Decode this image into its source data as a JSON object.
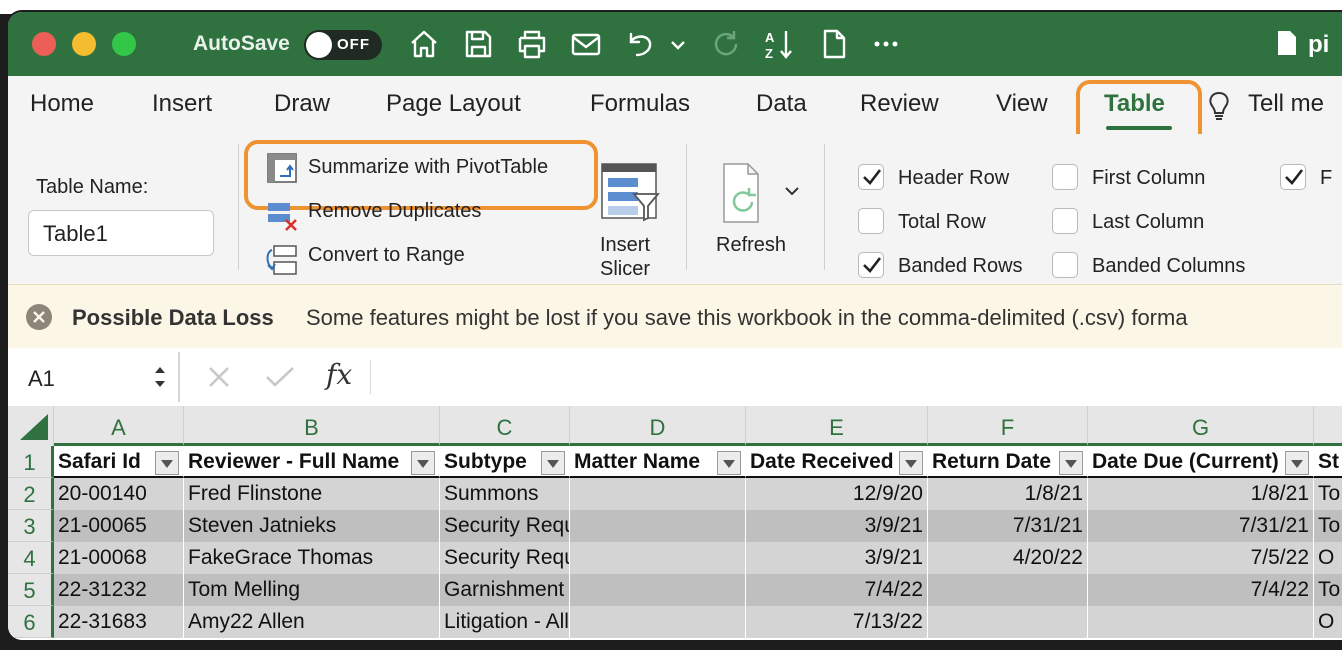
{
  "titlebar": {
    "autosave_label": "AutoSave",
    "autosave_state": "OFF",
    "filename": "pi",
    "colors": {
      "bar": "#2f7240",
      "close": "#ec5f57",
      "minimize": "#f4bd2f",
      "zoom": "#33c748"
    },
    "icons": [
      "home-icon",
      "save-icon",
      "print-icon",
      "mail-icon",
      "undo-icon",
      "chevron-down-icon",
      "redo-icon",
      "sort-az-icon",
      "document-icon",
      "more-icon"
    ]
  },
  "tabs": {
    "items": [
      "Home",
      "Insert",
      "Draw",
      "Page Layout",
      "Formulas",
      "Data",
      "Review",
      "View",
      "Table"
    ],
    "active": "Table",
    "tell_me": "Tell me",
    "highlight_color": "#ef9232"
  },
  "ribbon": {
    "table_name_label": "Table Name:",
    "table_name_value": "Table1",
    "summarize": "Summarize with PivotTable",
    "remove_duplicates": "Remove Duplicates",
    "convert_range": "Convert to Range",
    "insert_slicer_1": "Insert",
    "insert_slicer_2": "Slicer",
    "refresh": "Refresh",
    "options": {
      "header_row": {
        "label": "Header Row",
        "checked": true
      },
      "total_row": {
        "label": "Total Row",
        "checked": false
      },
      "banded_rows": {
        "label": "Banded Rows",
        "checked": true
      },
      "first_column": {
        "label": "First Column",
        "checked": false
      },
      "last_column": {
        "label": "Last Column",
        "checked": false
      },
      "banded_columns": {
        "label": "Banded Columns",
        "checked": false
      },
      "filter_button": {
        "label": "F",
        "checked": true
      }
    }
  },
  "message_bar": {
    "title": "Possible Data Loss",
    "text": "Some features might be lost if you save this workbook in the comma-delimited (.csv) forma"
  },
  "formula_bar": {
    "cell_ref": "A1",
    "fx": "fx",
    "content": ""
  },
  "sheet": {
    "columns": [
      "A",
      "B",
      "C",
      "D",
      "E",
      "F",
      "G"
    ],
    "rows": [
      "1",
      "2",
      "3",
      "4",
      "5",
      "6"
    ],
    "headers": [
      "Safari Id",
      "Reviewer - Full Name",
      "Subtype",
      "Matter Name",
      "Date Received",
      "Return Date",
      "Date Due (Current)",
      "St"
    ],
    "data": [
      [
        "20-00140",
        "Fred Flinstone",
        "Summons",
        "",
        "12/9/20",
        "1/8/21",
        "1/8/21",
        "To"
      ],
      [
        "21-00065",
        "Steven Jatnieks",
        "Security Request",
        "",
        "3/9/21",
        "7/31/21",
        "7/31/21",
        "To"
      ],
      [
        "21-00068",
        "FakeGrace Thomas",
        "Security Request",
        "",
        "3/9/21",
        "4/20/22",
        "7/5/22",
        "O"
      ],
      [
        "22-31232",
        "Tom Melling",
        "Garnishment - All Warnings",
        "",
        "7/4/22",
        "",
        "7/4/22",
        "To"
      ],
      [
        "22-31683",
        "Amy22 Allen",
        "Litigation - All Warnings",
        "",
        "7/13/22",
        "",
        "",
        "O"
      ]
    ],
    "band_colors": [
      "#d4d4d4",
      "#bfbfbf"
    ]
  }
}
